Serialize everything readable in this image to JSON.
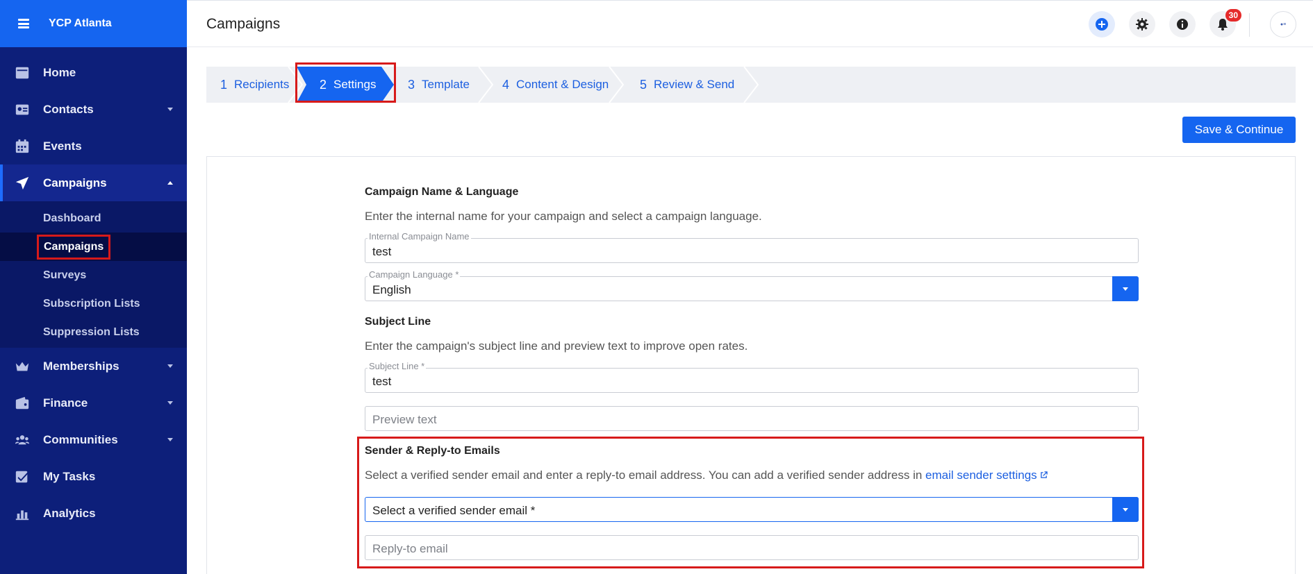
{
  "app": {
    "org_name": "YCP Atlanta"
  },
  "sidebar": {
    "items": [
      {
        "label": "Home",
        "icon": "home-icon"
      },
      {
        "label": "Contacts",
        "icon": "contacts-icon"
      },
      {
        "label": "Events",
        "icon": "calendar-icon"
      },
      {
        "label": "Campaigns",
        "icon": "paper-plane-icon"
      },
      {
        "label": "Memberships",
        "icon": "crown-icon"
      },
      {
        "label": "Finance",
        "icon": "wallet-icon"
      },
      {
        "label": "Communities",
        "icon": "people-icon"
      },
      {
        "label": "My Tasks",
        "icon": "checklist-icon"
      },
      {
        "label": "Analytics",
        "icon": "bar-chart-icon"
      }
    ],
    "campaign_subitems": [
      "Dashboard",
      "Campaigns",
      "Surveys",
      "Subscription Lists",
      "Suppression Lists"
    ]
  },
  "header": {
    "title": "Campaigns",
    "notification_count": "30"
  },
  "stepper": {
    "steps": [
      {
        "num": "1",
        "label": "Recipients"
      },
      {
        "num": "2",
        "label": "Settings"
      },
      {
        "num": "3",
        "label": "Template"
      },
      {
        "num": "4",
        "label": "Content & Design"
      },
      {
        "num": "5",
        "label": "Review & Send"
      }
    ]
  },
  "actions": {
    "save_continue": "Save & Continue"
  },
  "form": {
    "name_section": {
      "title": "Campaign Name & Language",
      "desc": "Enter the internal name for your campaign and select a campaign language.",
      "name_label": "Internal Campaign Name",
      "name_value": "test",
      "language_label": "Campaign Language *",
      "language_value": "English"
    },
    "subject_section": {
      "title": "Subject Line",
      "desc": "Enter the campaign's subject line and preview text to improve open rates.",
      "subject_label": "Subject Line *",
      "subject_value": "test",
      "preview_placeholder": "Preview text"
    },
    "sender_section": {
      "title": "Sender & Reply-to Emails",
      "desc": "Select a verified sender email and enter a reply-to email address. You can add a verified sender address in",
      "link_text": "email sender settings",
      "sender_placeholder": "Select a verified sender email *",
      "reply_placeholder": "Reply-to email"
    }
  },
  "colors": {
    "sidebar_bg": "#0d1f7a",
    "brand_bg": "#1565f0",
    "accent": "#1565f0",
    "highlight": "#d71a1a"
  }
}
